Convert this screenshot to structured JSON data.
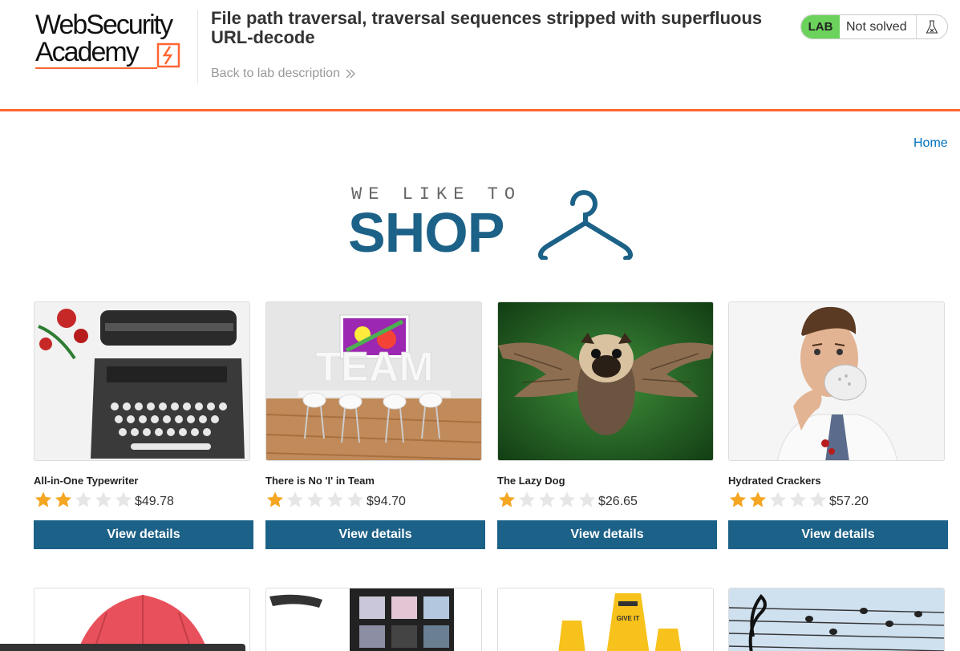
{
  "header": {
    "logo_line1": "WebSecurity",
    "logo_line2": "Academy",
    "lab_title": "File path traversal, traversal sequences stripped with superfluous URL-decode",
    "back_link": "Back to lab description",
    "status": {
      "tag": "LAB",
      "text": "Not solved",
      "tag_color": "#6bd35b"
    }
  },
  "nav": {
    "home": "Home"
  },
  "banner": {
    "small": "WE LIKE TO",
    "big": "SHOP"
  },
  "products": [
    {
      "name": "All-in-One Typewriter",
      "rating": 2,
      "max_rating": 5,
      "price": "$49.78",
      "button": "View details",
      "image_icon": "typewriter-image"
    },
    {
      "name": "There is No 'I' in Team",
      "rating": 1,
      "max_rating": 5,
      "price": "$94.70",
      "button": "View details",
      "image_icon": "team-image"
    },
    {
      "name": "The Lazy Dog",
      "rating": 1,
      "max_rating": 5,
      "price": "$26.65",
      "button": "View details",
      "image_icon": "flying-pug-image"
    },
    {
      "name": "Hydrated Crackers",
      "rating": 2,
      "max_rating": 5,
      "price": "$57.20",
      "button": "View details",
      "image_icon": "man-eating-cracker-image"
    }
  ],
  "colors": {
    "accent": "#ff6633",
    "primary": "#1c6187",
    "star": "#f5a623",
    "star_empty": "#e6e6e6",
    "link": "#0071bc"
  }
}
